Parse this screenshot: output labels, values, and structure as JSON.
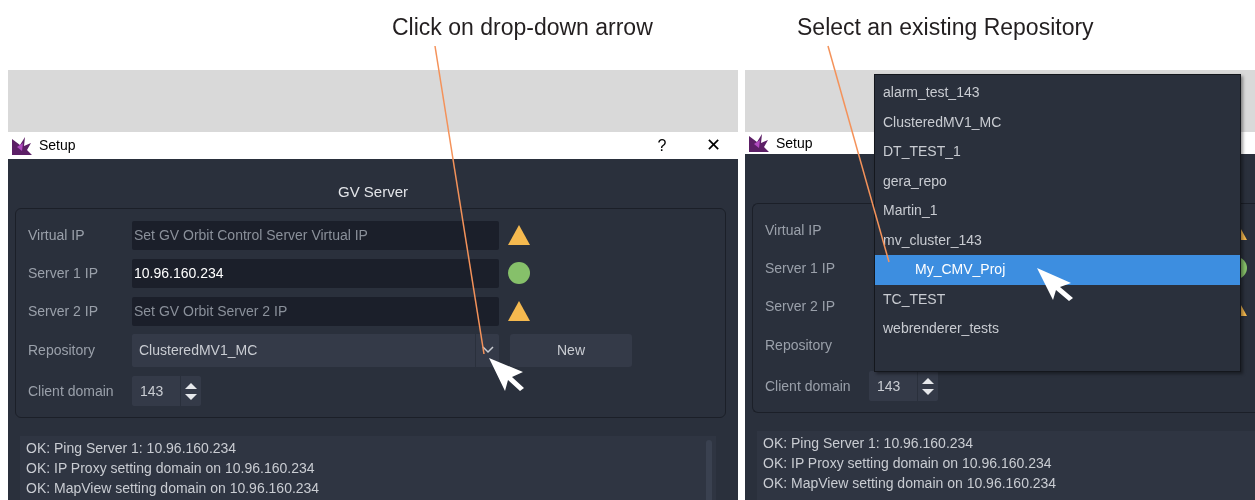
{
  "callouts": [
    {
      "text": "Click on drop-down arrow"
    },
    {
      "text": "Select an existing Repository"
    }
  ],
  "left_dialog": {
    "title": "Setup",
    "help_button": "?",
    "close_button": "✕",
    "section_title": "GV Server",
    "fields": [
      {
        "label": "Virtual IP",
        "placeholder": "Set GV Orbit Control Server Virtual IP",
        "kind": "warning"
      },
      {
        "label": "Server 1 IP",
        "value": "10.96.160.234",
        "kind": "ok"
      },
      {
        "label": "Server 2 IP",
        "placeholder": "Set GV Orbit Server 2 IP",
        "kind": "warning"
      }
    ],
    "repository": {
      "label": "Repository",
      "value": "ClusteredMV1_MC",
      "new_button": "New"
    },
    "client_domain": {
      "label": "Client domain",
      "value": "143"
    },
    "log": [
      "OK: Ping Server 1: 10.96.160.234",
      "OK: IP Proxy setting domain on 10.96.160.234",
      "OK: MapView setting domain on 10.96.160.234"
    ]
  },
  "right_dialog": {
    "title": "Setup",
    "fields": [
      {
        "label": "Virtual IP",
        "kind": "warning"
      },
      {
        "label": "Server 1 IP",
        "kind": "ok"
      },
      {
        "label": "Server 2 IP",
        "kind": "warning"
      }
    ],
    "repository": {
      "label": "Repository"
    },
    "client_domain": {
      "label": "Client domain",
      "value": "143"
    },
    "log": [
      "OK: Ping Server 1: 10.96.160.234",
      "OK: IP Proxy setting domain on 10.96.160.234",
      "OK: MapView setting domain on 10.96.160.234"
    ],
    "dropdown": {
      "items": [
        {
          "label": "alarm_test_143",
          "selected": false
        },
        {
          "label": "ClusteredMV1_MC",
          "selected": false
        },
        {
          "label": "DT_TEST_1",
          "selected": false
        },
        {
          "label": "gera_repo",
          "selected": false
        },
        {
          "label": "Martin_1",
          "selected": false
        },
        {
          "label": "mv_cluster_143",
          "selected": false
        },
        {
          "label": "My_CMV_Proj",
          "selected": true
        },
        {
          "label": "TC_TEST",
          "selected": false
        },
        {
          "label": "webrenderer_tests",
          "selected": false
        }
      ]
    }
  }
}
